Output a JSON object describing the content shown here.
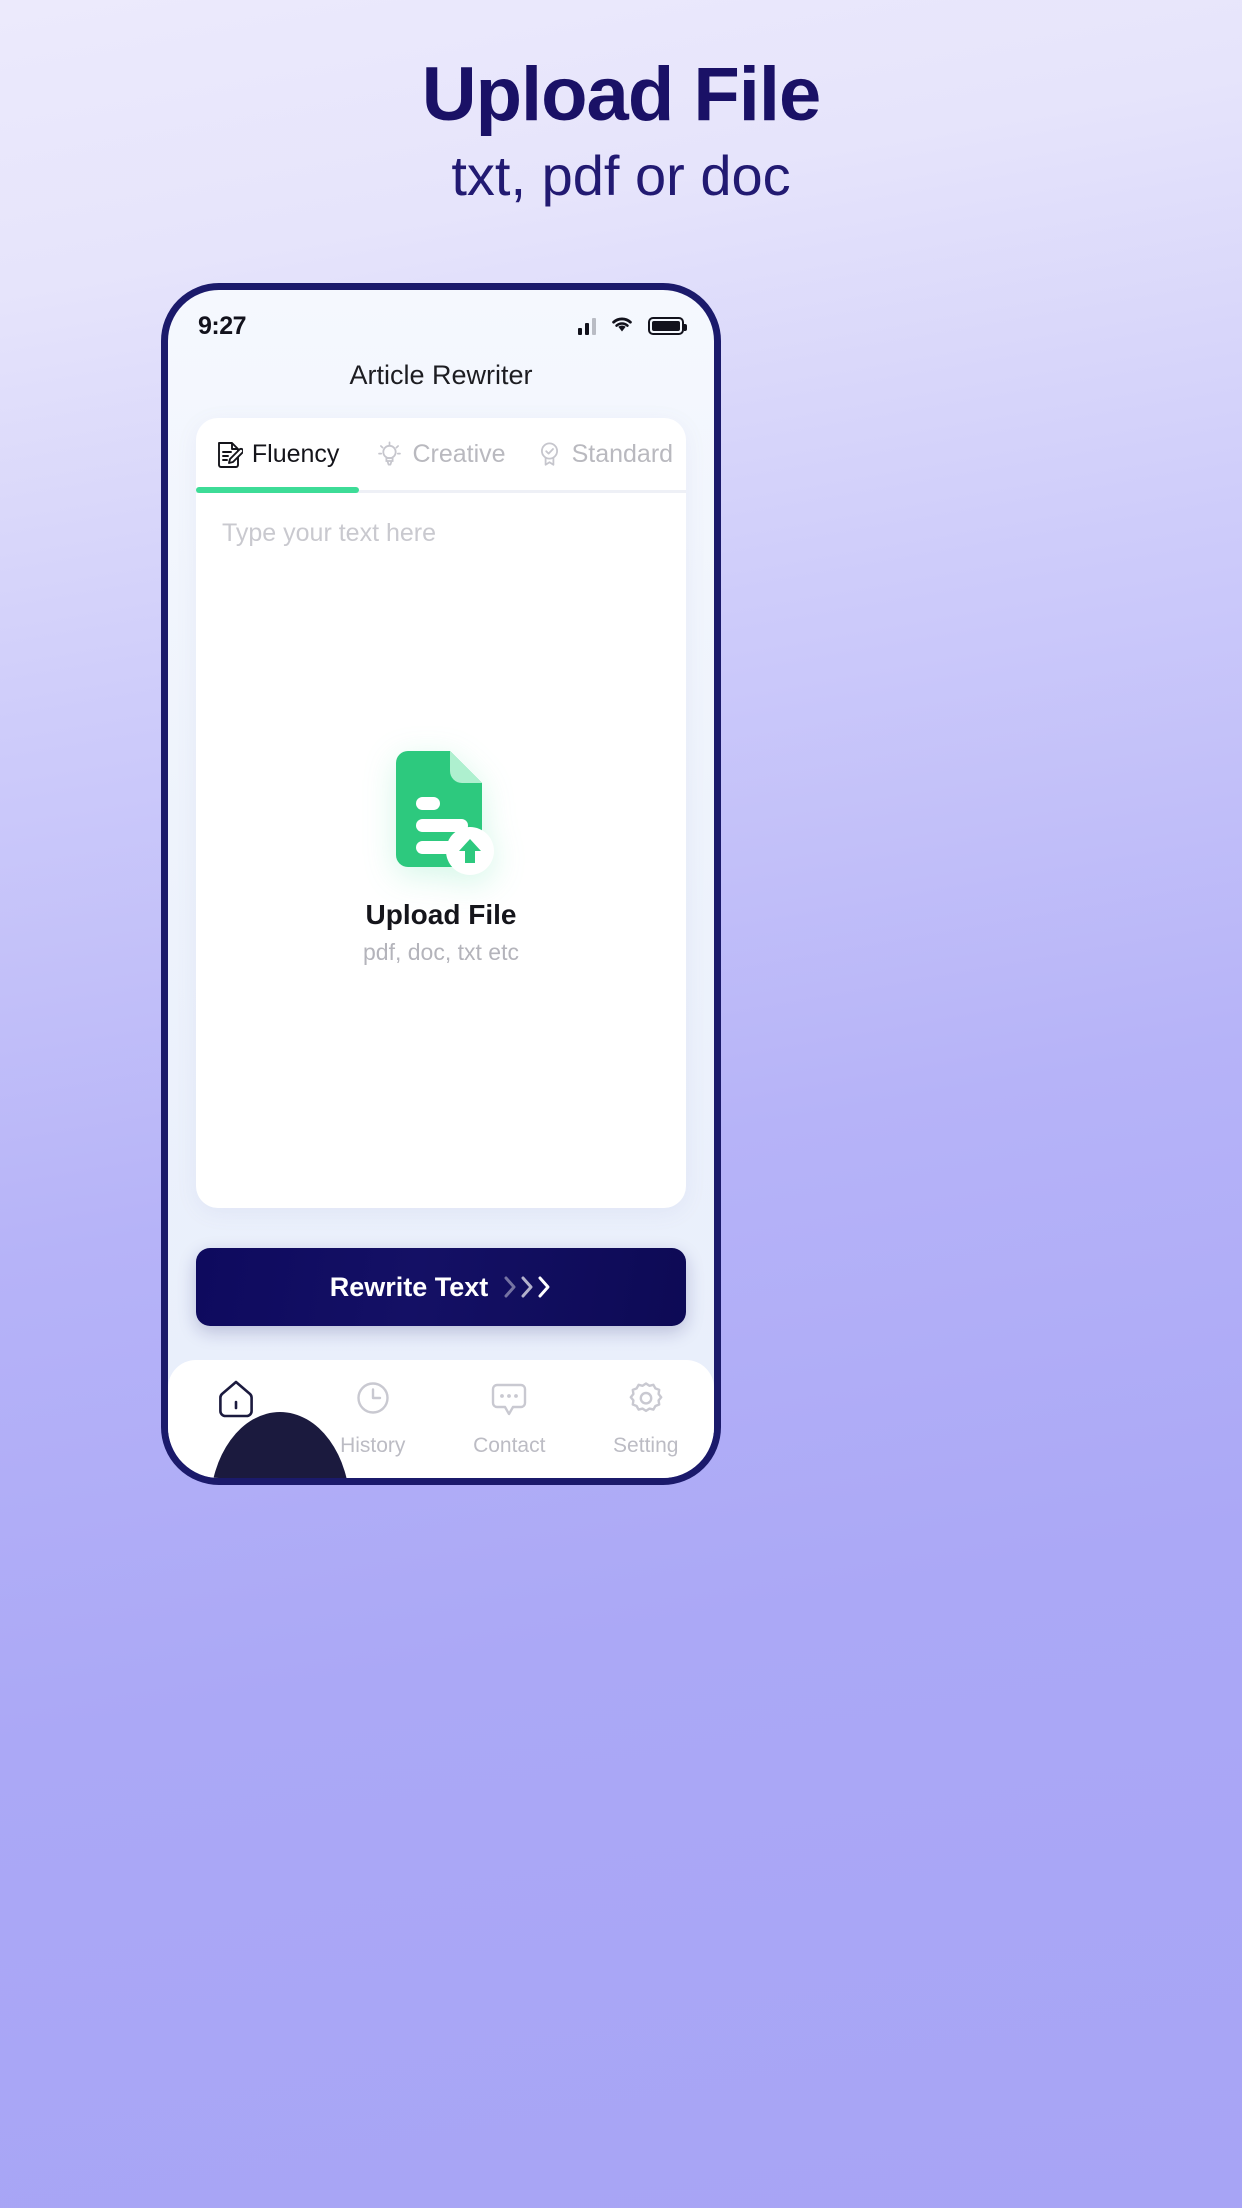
{
  "promo": {
    "title": "Upload File",
    "subtitle": "txt, pdf or doc"
  },
  "colors": {
    "background_purple": "#a7a4f5",
    "phone_border_navy": "#1b1a6b",
    "accent_green": "#3ddc97",
    "button_navy": "#0e0a5e",
    "muted_gray": "#bcbcc4"
  },
  "phone": {
    "status_bar": {
      "time": "9:27",
      "signal_icon": "signal-bars-icon",
      "wifi_icon": "wifi-icon",
      "battery_icon": "battery-full-icon"
    },
    "app_title": "Article Rewriter",
    "tabs": [
      {
        "label": "Fluency",
        "icon": "document-pencil-icon",
        "active": true
      },
      {
        "label": "Creative",
        "icon": "lightbulb-icon",
        "active": false
      },
      {
        "label": "Standard",
        "icon": "badge-check-icon",
        "active": false
      }
    ],
    "editor": {
      "placeholder": "Type your text here",
      "value": ""
    },
    "dropzone": {
      "icon": "upload-document-icon",
      "title": "Upload File",
      "subtitle": "pdf, doc, txt etc"
    },
    "primary_button": {
      "label": "Rewrite Text",
      "icon": "chevrons-right-icon"
    },
    "bottom_nav": [
      {
        "label": "",
        "icon": "home-icon",
        "active": true
      },
      {
        "label": "History",
        "icon": "clock-icon",
        "active": false
      },
      {
        "label": "Contact",
        "icon": "chat-icon",
        "active": false
      },
      {
        "label": "Setting",
        "icon": "gear-icon",
        "active": false
      }
    ]
  }
}
